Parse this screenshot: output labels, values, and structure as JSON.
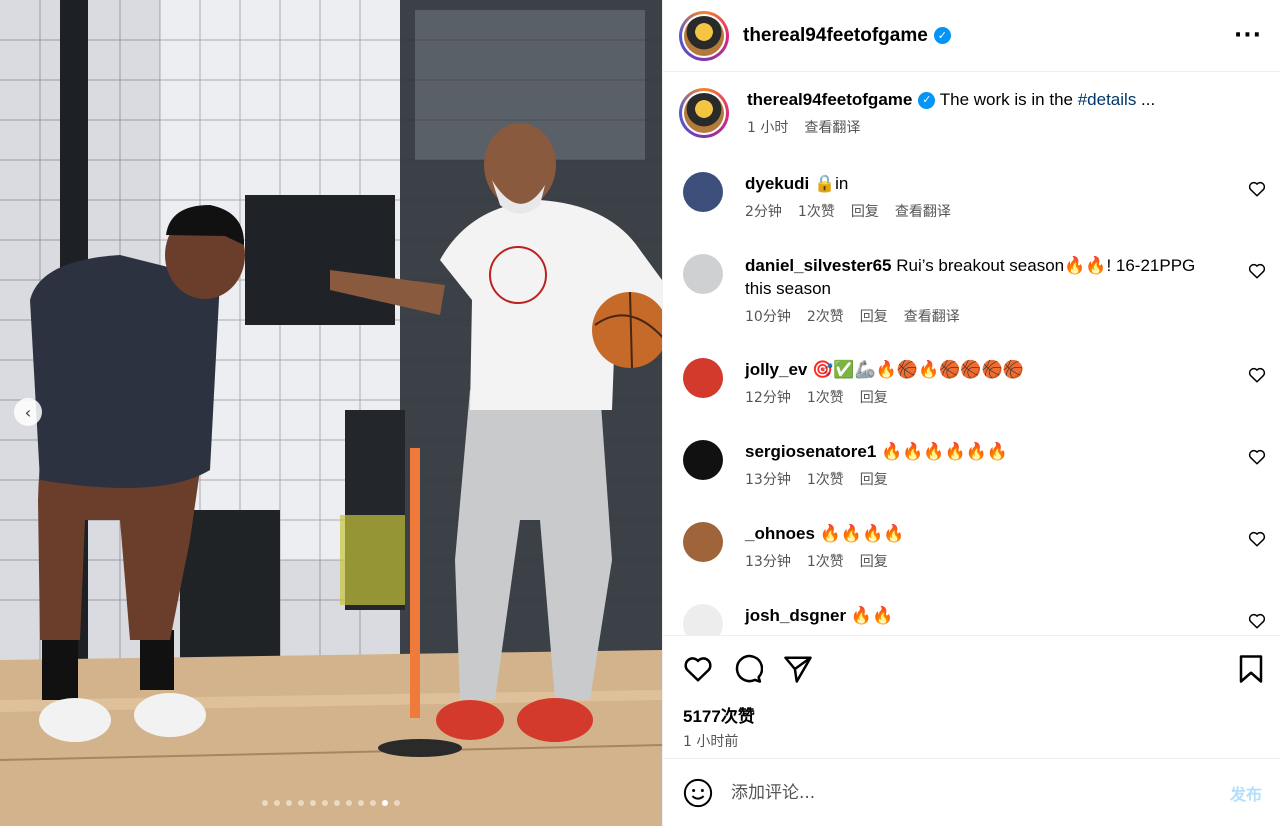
{
  "photo": {
    "carousel_total": 12,
    "carousel_active": 11
  },
  "post": {
    "username": "thereal94feetofgame",
    "caption_text": "The work is in the ",
    "caption_hashtag": "#details",
    "caption_more": " ...",
    "time": "1 小时",
    "translate": "查看翻译"
  },
  "comments": [
    {
      "user": "dyekudi",
      "text": "🔒in",
      "time": "2分钟",
      "likes": "1次赞",
      "reply": "回复",
      "translate": "查看翻译"
    },
    {
      "user": "daniel_silvester65",
      "text": "Rui’s breakout season🔥🔥! 16-21PPG this season",
      "time": "10分钟",
      "likes": "2次赞",
      "reply": "回复",
      "translate": "查看翻译"
    },
    {
      "user": "jolly_ev",
      "text": "🎯✅🦾🔥🏀🔥🏀🏀🏀🏀",
      "time": "12分钟",
      "likes": "1次赞",
      "reply": "回复"
    },
    {
      "user": "sergiosenatore1",
      "text": "🔥🔥🔥🔥🔥🔥",
      "time": "13分钟",
      "likes": "1次赞",
      "reply": "回复"
    },
    {
      "user": "_ohnoes",
      "text": "🔥🔥🔥🔥",
      "time": "13分钟",
      "likes": "1次赞",
      "reply": "回复"
    },
    {
      "user": "josh_dsgner",
      "text": "🔥🔥"
    }
  ],
  "actions": {
    "likes": "5177次赞",
    "ago": "1 小时前"
  },
  "add_comment": {
    "placeholder": "添加评论...",
    "post_label": "发布"
  },
  "colors": {
    "verified": "#0095f6",
    "hashtag": "#00376b",
    "post_button": "#b2dffc"
  }
}
